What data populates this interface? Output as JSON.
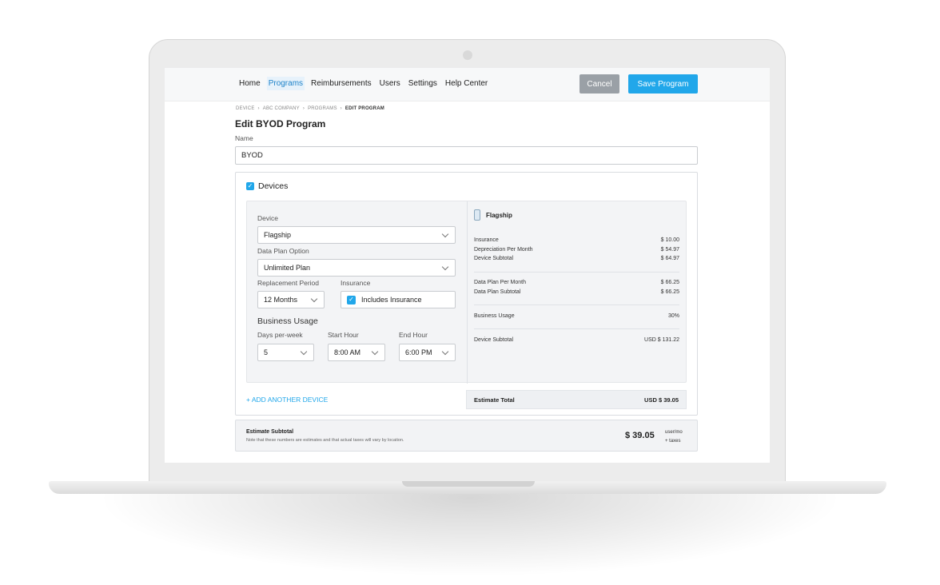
{
  "nav": {
    "items": [
      {
        "label": "Home",
        "active": false
      },
      {
        "label": "Programs",
        "active": true
      },
      {
        "label": "Reimbursements",
        "active": false
      },
      {
        "label": "Users",
        "active": false
      },
      {
        "label": "Settings",
        "active": false
      },
      {
        "label": "Help Center",
        "active": false
      }
    ],
    "cancel_label": "Cancel",
    "save_label": "Save Program"
  },
  "breadcrumb": [
    "DEVICE",
    "ABC COMPANY",
    "PROGRAMS",
    "EDIT PROGRAM"
  ],
  "page": {
    "title": "Edit BYOD Program",
    "name_label": "Name",
    "name_value": "BYOD"
  },
  "devices": {
    "section_label": "Devices",
    "checked": true,
    "device_label": "Device",
    "device_value": "Flagship",
    "data_plan_label": "Data Plan Option",
    "data_plan_value": "Unlimited Plan",
    "replacement_label": "Replacement Period",
    "replacement_value": "12 Months",
    "insurance_label": "Insurance",
    "insurance_checkbox_label": "Includes Insurance",
    "insurance_checked": true,
    "business_usage_title": "Business Usage",
    "days_label": "Days per-week",
    "days_value": "5",
    "start_label": "Start Hour",
    "start_value": "8:00 AM",
    "end_label": "End Hour",
    "end_value": "6:00 PM",
    "add_device_label": "+ ADD ANOTHER DEVICE"
  },
  "summary": {
    "title": "Flagship",
    "rows": [
      {
        "label": "Insurance",
        "value": "$ 10.00"
      },
      {
        "label": "Depreciation Per Month",
        "value": "$ 54.97"
      },
      {
        "label": "Device Subtotal",
        "value": "$ 64.97"
      },
      {
        "label": "Data Plan Per Month",
        "value": "$ 66.25"
      },
      {
        "label": "Data Plan Subtotal",
        "value": "$ 66.25"
      },
      {
        "label": "Business Usage",
        "value": "30%"
      },
      {
        "label": "Device Subtotal",
        "value": "USD $ 131.22"
      }
    ],
    "estimate_total_label": "Estimate Total",
    "estimate_total_value": "USD $ 39.05"
  },
  "subtotal": {
    "title": "Estimate Subtotal",
    "note": "Note that these numbers are estimates and that actual taxes will vary by location.",
    "amount": "$ 39.05",
    "unit_line1": "user/mo",
    "unit_line2": "+ taxes"
  },
  "colors": {
    "accent": "#21a7ea",
    "cancel": "#9aa0a6"
  }
}
